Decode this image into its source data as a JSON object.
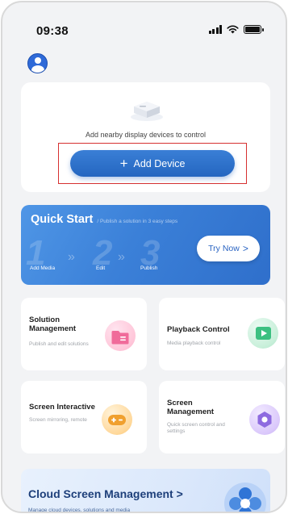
{
  "status_bar": {
    "time": "09:38"
  },
  "device_card": {
    "caption": "Add nearby display devices to control",
    "button_label": "Add Device"
  },
  "quick_start": {
    "title": "Quick Start",
    "subtitle": "/ Publish a solution in 3 easy steps",
    "steps": [
      {
        "number": "1",
        "label": "Add Media"
      },
      {
        "number": "2",
        "label": "Edit"
      },
      {
        "number": "3",
        "label": "Publish"
      }
    ],
    "cta_label": "Try Now",
    "cta_chevron": ">"
  },
  "features": [
    {
      "title": "Solution Management",
      "description": "Publish and edit solutions",
      "icon": "folder-icon",
      "accent": "#f06b9a"
    },
    {
      "title": "Playback Control",
      "description": "Media playback control",
      "icon": "play-icon",
      "accent": "#3cc081"
    },
    {
      "title": "Screen Interactive",
      "description": "Screen mirroring, remote",
      "icon": "gamepad-icon",
      "accent": "#f0a02e"
    },
    {
      "title": "Screen Management",
      "description": "Quick screen control and settings",
      "icon": "hex-nut-icon",
      "accent": "#8e6be0"
    }
  ],
  "cloud_banner": {
    "title": "Cloud Screen Management",
    "chevron": ">",
    "description": "Manage cloud devices, solutions and media"
  },
  "colors": {
    "primary_blue": "#2a6cc6",
    "highlight_red": "#d63030",
    "page_background": "#f2f3f5"
  }
}
